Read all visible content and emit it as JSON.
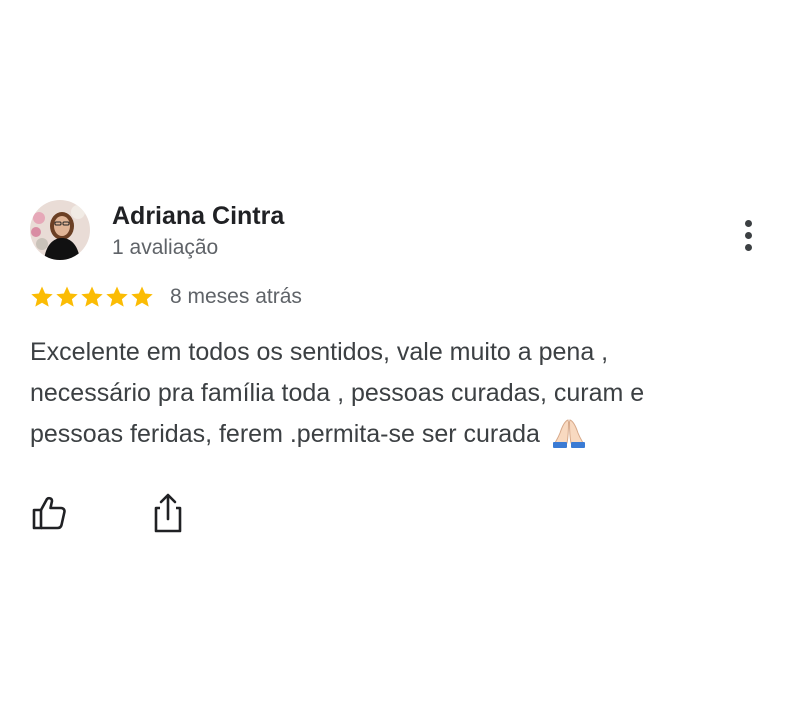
{
  "review": {
    "reviewer_name": "Adriana Cintra",
    "review_count": "1 avaliação",
    "rating": 5,
    "rating_max": 5,
    "date": "8 meses atrás",
    "text_lines": [
      "Excelente em todos os sentidos, vale muito a pena ,",
      "necessário pra família toda , pessoas curadas, curam e",
      "pessoas feridas, ferem .permita-se ser curada"
    ],
    "trailing_icon": "folded-hands-emoji"
  },
  "actions": {
    "like_icon": "thumbs-up-icon",
    "share_icon": "share-icon",
    "more_icon": "more-vert-icon"
  },
  "colors": {
    "star": "#FBBC04",
    "name": "#202124",
    "secondary_text": "#5f6368",
    "body_text": "#3c4043"
  }
}
